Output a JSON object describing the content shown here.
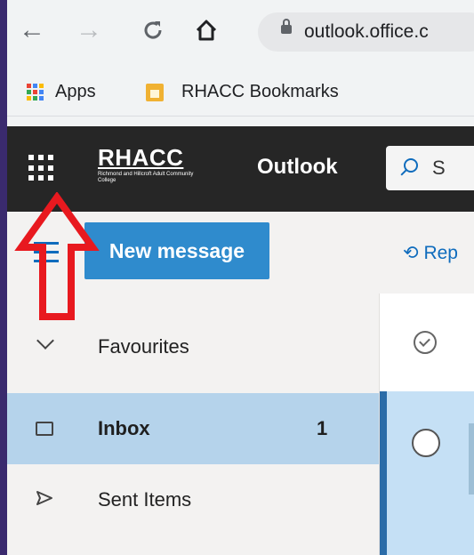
{
  "browser": {
    "url": "outlook.office.c",
    "apps_label": "Apps",
    "bookmark_folder": "RHACC Bookmarks"
  },
  "header": {
    "brand": "RHACC",
    "brand_tagline": "Richmond and Hillcroft Adult Community College",
    "app_name": "Outlook",
    "search_placeholder": "S"
  },
  "commands": {
    "new_message": "New message",
    "reply": "Rep"
  },
  "folders": {
    "favourites": "Favourites",
    "items": [
      {
        "label": "Inbox",
        "count": "1"
      },
      {
        "label": "Sent Items"
      }
    ]
  },
  "colors": {
    "header_bg": "#262626",
    "accent": "#2f8bcd",
    "selected_row": "#b5d3eb",
    "annotation": "#e8191f",
    "frame": "#3a2a6e"
  }
}
